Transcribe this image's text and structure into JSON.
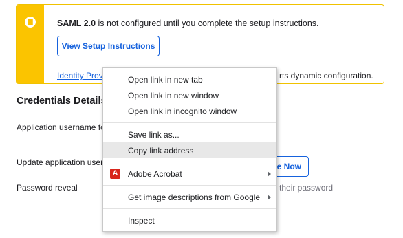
{
  "notice": {
    "bold": "SAML 2.0",
    "text": " is not configured until you complete the setup instructions.",
    "button": "View Setup Instructions",
    "link": "Identity Prov",
    "tail": "rts dynamic configuration.",
    "icon": "list-icon",
    "accent": "#fbc400"
  },
  "credentials": {
    "title": "Credentials Details",
    "username_label": "Application username fo",
    "update_label": "Update application usern",
    "update_button": "te Now",
    "reveal_label": "Password reveal",
    "reveal_tail": "e their password"
  },
  "menu": {
    "items": [
      "Open link in new tab",
      "Open link in new window",
      "Open link in incognito window",
      "Save link as...",
      "Copy link address",
      "Adobe Acrobat",
      "Get image descriptions from Google",
      "Inspect"
    ],
    "acrobat_icon": "adobe-acrobat-icon"
  },
  "colors": {
    "link": "#1662dd",
    "warning": "#fbc400",
    "highlight": "#e8e8e8"
  }
}
